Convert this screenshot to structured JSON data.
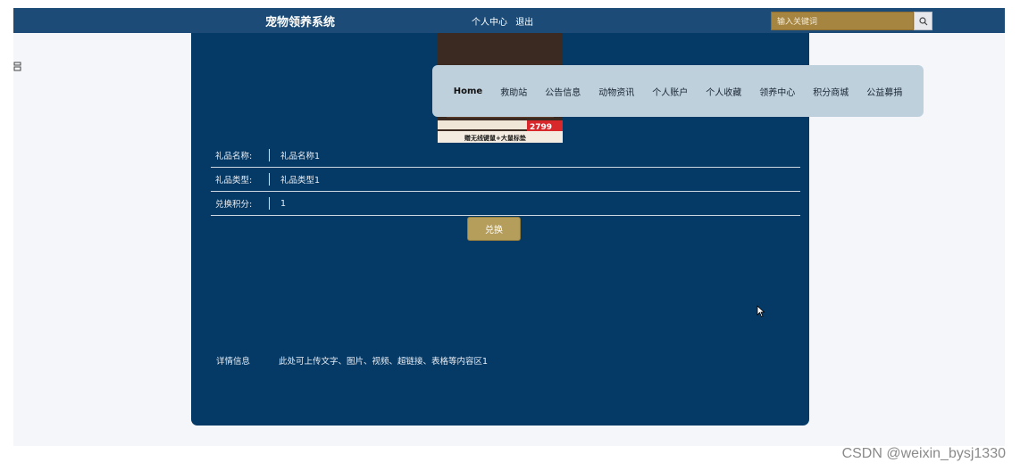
{
  "header": {
    "site_title": "宠物领养系统",
    "links": [
      "个人中心",
      "退出"
    ],
    "search_placeholder": "输入关键词"
  },
  "sidebar_fragment": "⁠",
  "nav": {
    "items": [
      "Home",
      "救助站",
      "公告信息",
      "动物资讯",
      "个人账户",
      "个人收藏",
      "领养中心",
      "积分商城",
      "公益募捐"
    ]
  },
  "product": {
    "image_badge_price": "2799",
    "image_caption": "赠无线键鼠+大鼠标垫",
    "fields": [
      {
        "label": "礼品名称:",
        "value": "礼品名称1"
      },
      {
        "label": "礼品类型:",
        "value": "礼品类型1"
      },
      {
        "label": "兑换积分:",
        "value": "1"
      }
    ],
    "exchange_label": "兑换",
    "detail_label": "详情信息",
    "detail_text": "此处可上传文字、图片、视频、超链接、表格等内容区1"
  },
  "watermark": "CSDN @weixin_bysj1330",
  "colors": {
    "topbar": "#1b4b76",
    "panel": "#063a66",
    "nav_bg": "#bfd0dd",
    "accent_gold": "#b59d5b",
    "search_bg": "#a68540"
  }
}
